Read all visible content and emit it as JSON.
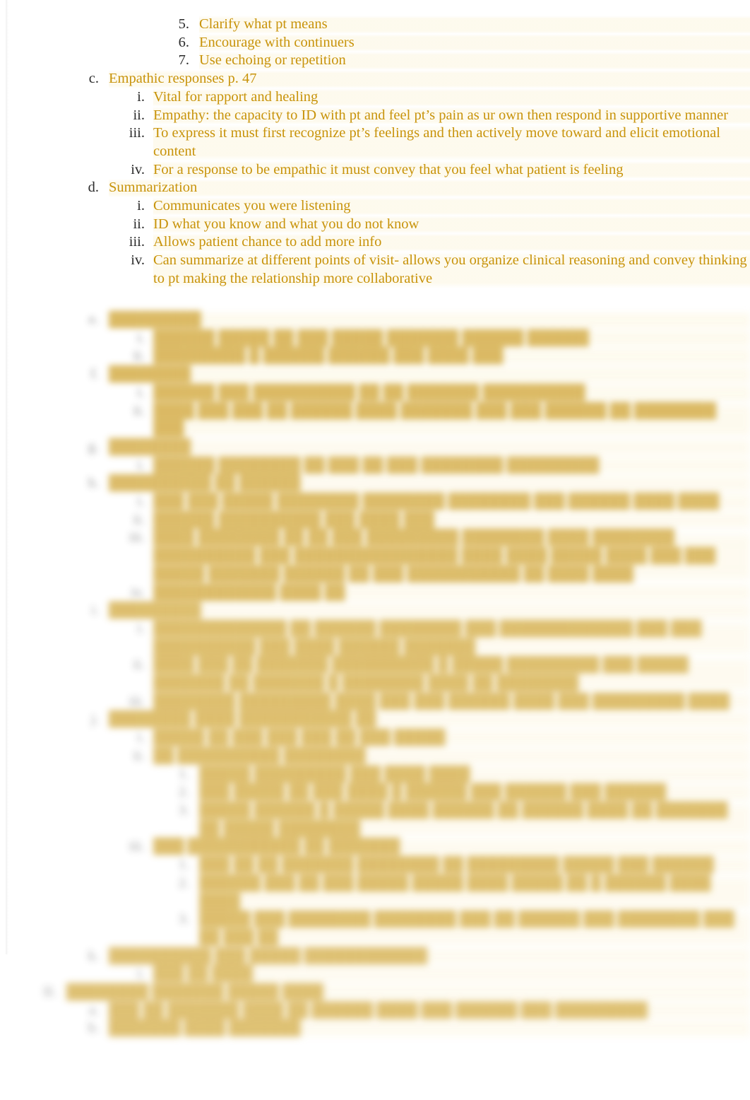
{
  "document": {
    "type": "outline-notes",
    "text_color": "#C8930A",
    "marker_color": "#2b2b2b",
    "background_color": "#ffffff",
    "highlight_color": "#FCF6DF",
    "blurred_text_color": "#D8B457"
  },
  "legible": {
    "numbered_items": [
      {
        "marker": "5.",
        "text": "Clarify what pt means"
      },
      {
        "marker": "6.",
        "text": "Encourage with continuers"
      },
      {
        "marker": "7.",
        "text": "Use echoing or repetition"
      }
    ],
    "section_c": {
      "marker": "c.",
      "heading": "Empathic responses p. 47",
      "items": [
        {
          "marker": "i.",
          "text": "Vital for rapport and healing"
        },
        {
          "marker": "ii.",
          "text": "Empathy: the capacity to ID with pt and feel pt’s pain as ur own then respond in supportive manner"
        },
        {
          "marker": "iii.",
          "text": "To express it must first recognize pt’s feelings and then actively move toward and elicit emotional content"
        },
        {
          "marker": "iv.",
          "text": "For a response to be empathic it must convey that you feel what patient is feeling"
        }
      ]
    },
    "section_d": {
      "marker": "d.",
      "heading": "Summarization",
      "items": [
        {
          "marker": "i.",
          "text": "Communicates you were listening"
        },
        {
          "marker": "ii.",
          "text": "ID what you know and what you do not know"
        },
        {
          "marker": "iii.",
          "text": "Allows patient chance to add more info"
        },
        {
          "marker": "iv.",
          "text": "Can summarize at different points of visit- allows you organize clinical reasoning and convey thinking to pt making the relationship more collaborative"
        }
      ]
    }
  },
  "blurred": {
    "note": "Lower portion of the page is visually blurred and illegible; only outline structure and marker positions are discernible.",
    "blocks": [
      {
        "marker": "e.",
        "heading": "█████████",
        "items": [
          {
            "marker": "i.",
            "text": "██████ █████ ██ ███ █████ ███████ ██████ ██████"
          },
          {
            "marker": "ii.",
            "text": "█████████ █ ██████ ██████ ███ ████ ███"
          }
        ]
      },
      {
        "marker": "f.",
        "heading": "████████",
        "items": [
          {
            "marker": "i.",
            "text": "██████ ███ ██████████ ██ ██ ███████ ██████████"
          },
          {
            "marker": "ii.",
            "text": "████ ███ ███ ██ ██████ ████ ███████ ███ ███ ██████ ██ ████████ ███"
          }
        ]
      },
      {
        "marker": "g.",
        "heading": "████████",
        "items": [
          {
            "marker": "i.",
            "text": "██████ ████████ ██ ███ ██ ███ ████████ █████████"
          }
        ]
      },
      {
        "marker": "h.",
        "heading": "██████████ ██ ██████",
        "items": [
          {
            "marker": "i.",
            "text": "███ ███ █████ ████████ ████████ ████████ ███ ██████ ████ ████"
          },
          {
            "marker": "ii.",
            "text": "██████ ██████████ ███ ████ ███"
          },
          {
            "marker": "iii.",
            "text": "████ ████████ ██ ██ ███ █████████ ████████ ████ ████████ ██████████ ███ ████████████████ ████ ████ █████ ████ ███ ███ █████ ███████ ██████ ██ ███ ███████████ ██ ████ ████"
          },
          {
            "marker": "iv.",
            "text": "████████████ ████ ██"
          }
        ]
      },
      {
        "marker": "i.",
        "heading": "█████████",
        "items": [
          {
            "marker": "i.",
            "text": "█████████████ ██ ██████ ████████ ███ █████████████ ███ ███ ██████████ ███ ████ ██████ ███████"
          },
          {
            "marker": "ii.",
            "text": "████ ███ ██ ███████ ██████████ █ █████ █████████ ███ █████ ███████ ██ ███████ █ ████████ ████ ██ ████████"
          },
          {
            "marker": "iii.",
            "text": "████████ █████████ ████ ███ ███ ██████ ████ ███ █████████ ████"
          }
        ]
      },
      {
        "marker": "j.",
        "heading": "████████ ████ ███████████ ██",
        "items": [
          {
            "marker": "i.",
            "text": "█████ ██ ███ ███ ███ ██ ███ █████"
          },
          {
            "marker": "ii.",
            "text": "██ ██████████ ████████",
            "subitems": [
              {
                "marker": "1.",
                "text": "█████ █████████ ███ ████ ████"
              },
              {
                "marker": "2.",
                "text": "███ █████ ██ ███ ████  █ ██████ ███ ██████ ███ ██████"
              },
              {
                "marker": "3.",
                "text": "█████ ██████ █ █████  ████ ██████  ██ ██████  ████ ██ ███████  ██ █████ ████████"
              }
            ]
          },
          {
            "marker": "iii.",
            "text": "███ ███████████ ██ ███████",
            "subitems": [
              {
                "marker": "1.",
                "text": "███ ██ ██ ███████ ████████ ██ █████████ █████ ███ ██████"
              },
              {
                "marker": "2.",
                "text": "██████ ███ ██ ███ █████ █████ ████  █████ ██ █ ██████ ████ ████"
              },
              {
                "marker": "3.",
                "text": "█████ ███ ████████ ████████ ███ ██ ██████ ███ ████████  ███ ██ ███ ██"
              }
            ]
          }
        ]
      },
      {
        "marker": "k.",
        "heading": "██████████ ███ █████ ████████████",
        "items": [
          {
            "marker": "i.",
            "text": "███ ██ ████"
          }
        ]
      }
    ],
    "bottom_section": {
      "marker": "II.",
      "heading": "████████ ███████ █████ ████",
      "items": [
        {
          "marker": "a.",
          "text": "███ ██ ███████ ████ ██ ██████ ████ ███ ██████ ███ █████████"
        },
        {
          "marker": "b.",
          "text": "███████ ████ ███████"
        }
      ]
    }
  }
}
